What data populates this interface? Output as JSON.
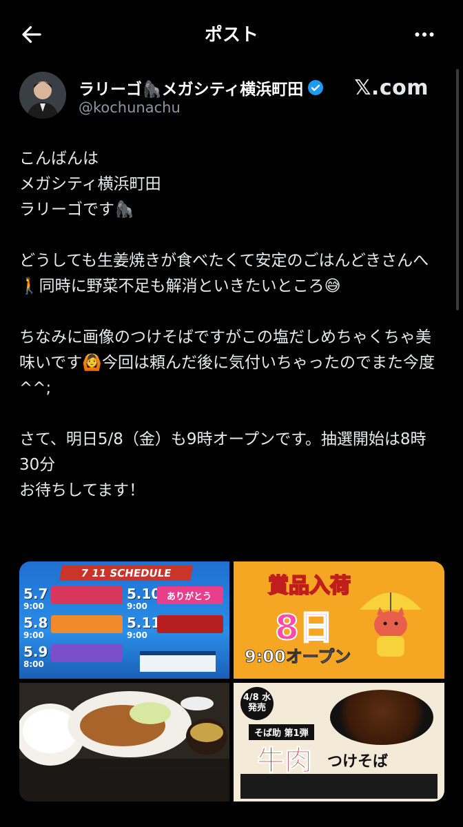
{
  "header": {
    "title": "ポスト"
  },
  "author": {
    "name": "ラリーゴ🦍メガシティ横浜町田",
    "handle": "@kochunachu",
    "source_label": "𝕏.com"
  },
  "post": {
    "text": "こんばんは\nメガシティ横浜町田\nラリーゴです🦍\n\nどうしても生姜焼きが食べたくて安定のごはんどきさんへ🚶同時に野菜不足も解消といきたいところ😅\n\nちなみに画像のつけそばですがこの塩だしめちゃくちゃ美味いです🙆今回は頼んだ後に気付いちゃったのでまた今度^^;\n\nさて、明日5/8（金）も9時オープンです。抽選開始は8時30分\nお待ちしてます！"
  },
  "media": {
    "schedule": {
      "banner": "7 11 SCHEDULE",
      "entries": [
        {
          "date": "5.7",
          "time": "9:00"
        },
        {
          "date": "5.8",
          "time": "9:00"
        },
        {
          "date": "5.9",
          "time": "8:00"
        },
        {
          "date": "5.10",
          "time": "9:00"
        },
        {
          "date": "5.11",
          "time": "9:00"
        }
      ],
      "card_label": "ありがとう"
    },
    "award": {
      "title": "賞品入荷",
      "day": "8日",
      "open": "9:00オープン"
    },
    "tsukesoba": {
      "date_badge": "4/8 水 発売",
      "series": "そば助 第1弾",
      "title": "牛肉",
      "subtitle": "つけそば"
    }
  },
  "colors": {
    "background": "#000000",
    "text": "#e7e9ea",
    "secondary": "#8b98a5",
    "verified": "#1d9bf0"
  }
}
